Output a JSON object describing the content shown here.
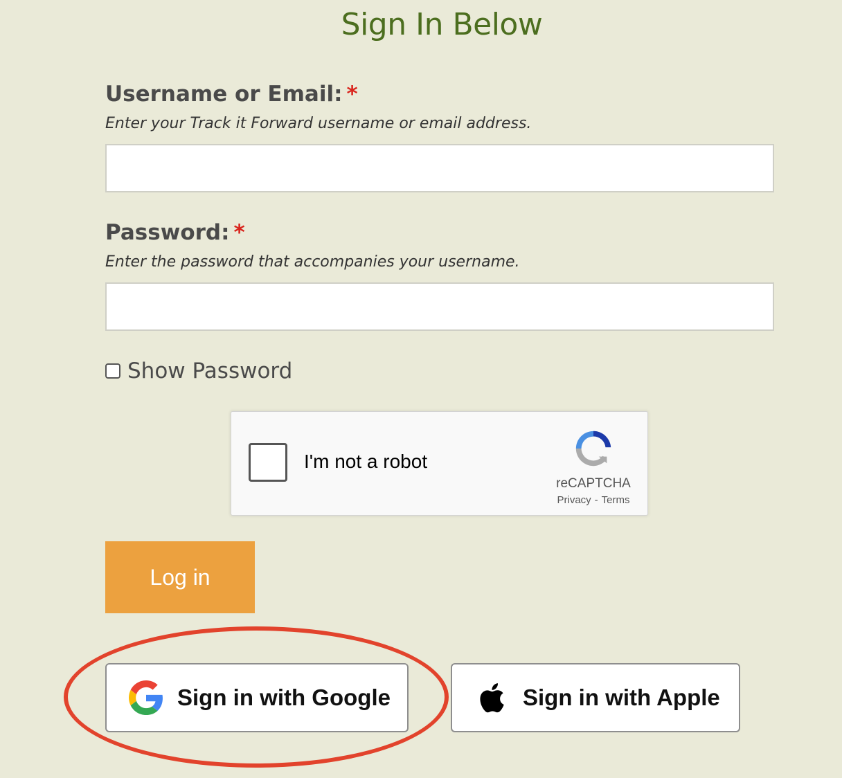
{
  "page": {
    "title": "Sign In Below"
  },
  "username": {
    "label": "Username or Email:",
    "required_mark": "*",
    "description": "Enter your Track it Forward username or email address.",
    "value": "",
    "placeholder": ""
  },
  "password": {
    "label": "Password:",
    "required_mark": "*",
    "description": "Enter the password that accompanies your username.",
    "value": "",
    "placeholder": ""
  },
  "show_password": {
    "label": "Show Password",
    "checked": false
  },
  "recaptcha": {
    "label": "I'm not a robot",
    "brand": "reCAPTCHA",
    "privacy": "Privacy",
    "separator": "-",
    "terms": "Terms",
    "checked": false,
    "icon": "recaptcha-logo-icon"
  },
  "login_button": {
    "label": "Log in"
  },
  "sso": {
    "google": {
      "label": "Sign in with Google",
      "icon": "google-icon"
    },
    "apple": {
      "label": "Sign in with Apple",
      "icon": "apple-icon"
    }
  },
  "colors": {
    "background": "#eaead8",
    "title": "#4c6e1f",
    "required": "#d9241c",
    "login_button": "#eca13f",
    "highlight": "#e2432c"
  }
}
